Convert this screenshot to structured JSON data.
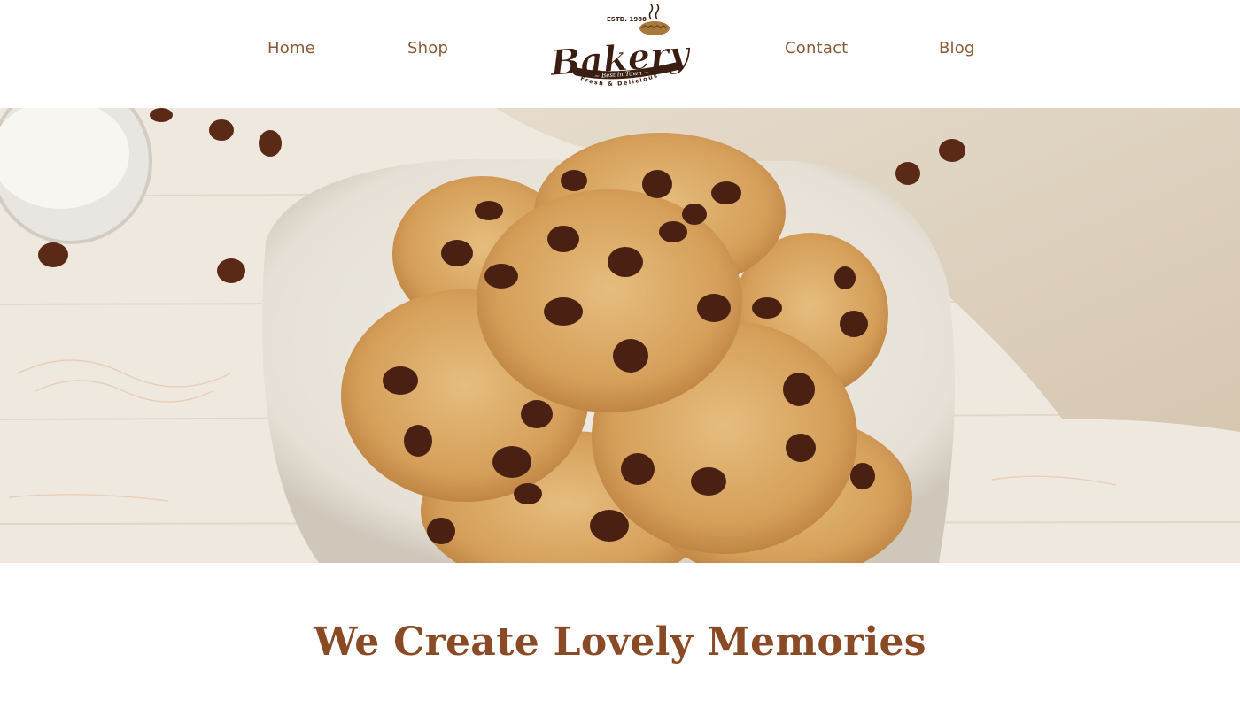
{
  "nav": {
    "home": "Home",
    "shop": "Shop",
    "contact": "Contact",
    "blog": "Blog"
  },
  "logo": {
    "name": "Bakery",
    "established": "ESTD. 1988",
    "tagline": "~ Best in Town ~",
    "subtitle": "Fresh & Delicious"
  },
  "hero": {
    "image": "chocolate-chip-cookies-on-plate"
  },
  "headline": "We Create Lovely Memories",
  "colors": {
    "nav_text": "#8a5a38",
    "headline": "#8b4a26",
    "logo_brown": "#3b1d12"
  }
}
